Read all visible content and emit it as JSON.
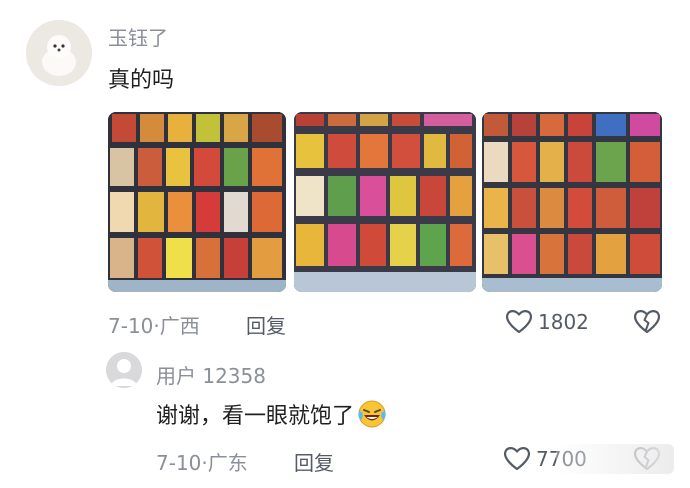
{
  "comment": {
    "username": "玉钰了",
    "text": "真的吗",
    "date": "7-10",
    "location": "广西",
    "reply_label": "回复",
    "like_count": "1802",
    "photos": [
      {
        "alt": "snack shelf photo 1"
      },
      {
        "alt": "snack shelf photo 2"
      },
      {
        "alt": "snack shelf photo 3"
      }
    ]
  },
  "reply": {
    "username": "用户 12358",
    "text": "谢谢，看一眼就饱了",
    "date": "7-10",
    "location": "广东",
    "reply_label": "回复",
    "like_count": "7700"
  },
  "separator": "·",
  "icons": {
    "like": "heart-outline-icon",
    "dislike": "broken-heart-icon",
    "emoji": "laughing-tears-emoji"
  },
  "colors": {
    "meta_text": "#8a8f99",
    "body_text": "#1f1f1f",
    "action_text": "#555b66"
  }
}
